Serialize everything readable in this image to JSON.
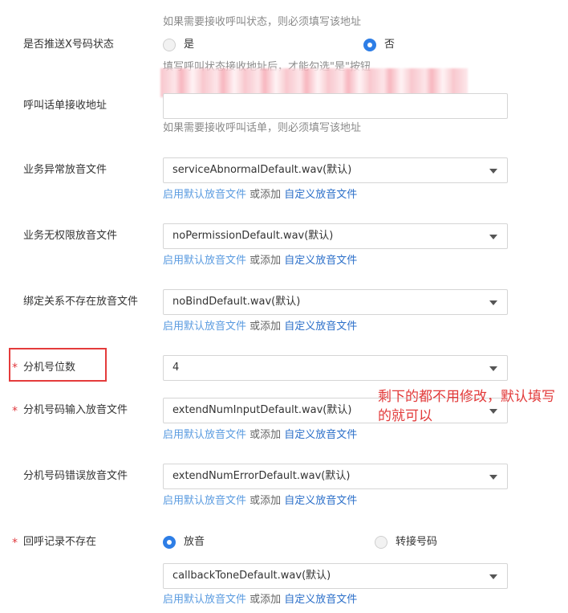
{
  "hint_top": "如果需要接收呼叫状态，则必须填写该地址",
  "push_x": {
    "label": "是否推送X号码状态",
    "option_yes": "是",
    "option_no": "否",
    "selected": "否",
    "hint": "填写呼叫状态接收地址后，才能勾选\"是\"按钮"
  },
  "bill_address": {
    "label": "呼叫话单接收地址",
    "value": "",
    "hint": "如果需要接收呼叫话单，则必须填写该地址"
  },
  "link_default": "启用默认放音文件",
  "link_or": " 或添加 ",
  "link_custom": "自定义放音文件",
  "fields": {
    "abnormal": {
      "label": "业务异常放音文件",
      "value": "serviceAbnormalDefault.wav(默认)"
    },
    "no_permission": {
      "label": "业务无权限放音文件",
      "value": "noPermissionDefault.wav(默认)"
    },
    "no_bind": {
      "label": "绑定关系不存在放音文件",
      "value": "noBindDefault.wav(默认)"
    },
    "ext_digits": {
      "label": "分机号位数",
      "value": "4",
      "required": true
    },
    "ext_input": {
      "label": "分机号码输入放音文件",
      "value": "extendNumInputDefault.wav(默认)",
      "required": true
    },
    "ext_error": {
      "label": "分机号码错误放音文件",
      "value": "extendNumErrorDefault.wav(默认)"
    },
    "callback": {
      "label": "回呼记录不存在",
      "required": true,
      "option_play": "放音",
      "option_transfer": "转接号码",
      "selected": "放音",
      "value": "callbackToneDefault.wav(默认)"
    }
  },
  "required_mark": "*",
  "annotation": "剩下的都不用修改，默认填写的就可以",
  "colors": {
    "primary": "#2e7ee6",
    "link_light": "#5a9be0",
    "link": "#2b6fc9",
    "required": "#e0393e",
    "annotation": "#e23a3a"
  }
}
